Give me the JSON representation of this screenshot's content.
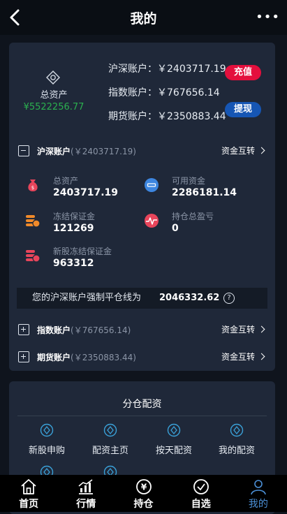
{
  "header": {
    "title": "我的",
    "more": "•••"
  },
  "summary": {
    "total_label": "总资产",
    "total_value": "¥5522256.77",
    "accounts": [
      {
        "label": "沪深账户：￥2403717.19"
      },
      {
        "label": "指数账户：￥767656.14"
      },
      {
        "label": "期货账户：￥2350883.44"
      }
    ],
    "recharge_label": "充值",
    "withdraw_label": "提现"
  },
  "hs_account": {
    "name": "沪深账户",
    "amount": "(￥2403717.19)",
    "transfer_label": "资金互转",
    "stats": [
      {
        "label": "总资产",
        "value": "2403717.19"
      },
      {
        "label": "可用资金",
        "value": "2286181.14"
      },
      {
        "label": "冻结保证金",
        "value": "121269"
      },
      {
        "label": "持仓总盈亏",
        "value": "0"
      },
      {
        "label": "新股冻结保证金",
        "value": "963312"
      }
    ],
    "liquidation_label": "您的沪深账户强制平仓线为",
    "liquidation_value": "2046332.62",
    "help_icon": "?"
  },
  "index_account": {
    "name": "指数账户",
    "amount": "(￥767656.14)",
    "transfer_label": "资金互转"
  },
  "futures_account": {
    "name": "期货账户",
    "amount": "(￥2350883.44)",
    "transfer_label": "资金互转"
  },
  "allocation": {
    "title": "分仓配资",
    "items": [
      {
        "label": "新股申购"
      },
      {
        "label": "配资主页"
      },
      {
        "label": "按天配资"
      },
      {
        "label": "我的配资"
      }
    ]
  },
  "tabbar": {
    "items": [
      {
        "label": "首页"
      },
      {
        "label": "行情"
      },
      {
        "label": "持仓"
      },
      {
        "label": "自选"
      },
      {
        "label": "我的"
      }
    ]
  },
  "colors": {
    "accent": "#4b8fd6",
    "recharge": "#e40f3d",
    "withdraw": "#1656b4",
    "positive": "#2bb04f"
  }
}
